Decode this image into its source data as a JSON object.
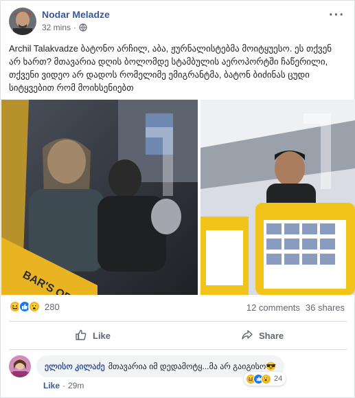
{
  "post": {
    "author": "Nodar Meladze",
    "time": "32 mins",
    "separator": "·",
    "more_label": "···",
    "text": "Archil Talakvadze ბატონო არჩილ, აბა, ჟურნალისტებმა მოიტყუესო. ეს თქვენ არ ხართ? მთავარია დღის ბოლომდე სტამბულის აეროპორტში ჩაწერილი, თქვენი ვიდეო არ დადოს რომელიმე ემიგრანტმა, ბატონ ბიძინას ცუდი სიტყვებით რომ მოიხსენიებთ"
  },
  "reactions": {
    "icons": [
      "haha-icon",
      "like-icon",
      "wow-icon"
    ],
    "count": "280",
    "comments": "12 comments",
    "shares": "36 shares"
  },
  "actions": {
    "like_label": "Like",
    "share_label": "Share"
  },
  "comment": {
    "author": "ელისო კილაძე",
    "text": "მთავარია იმ დედამოტყ...მა არ გაიგისო😎",
    "reaction_count": "24",
    "like_label": "Like",
    "separator": "·",
    "time": "29m"
  },
  "colors": {
    "link": "#385898",
    "muted": "#606770",
    "like_blue": "#1877f2",
    "emoji_yellow": "#f7b125"
  }
}
